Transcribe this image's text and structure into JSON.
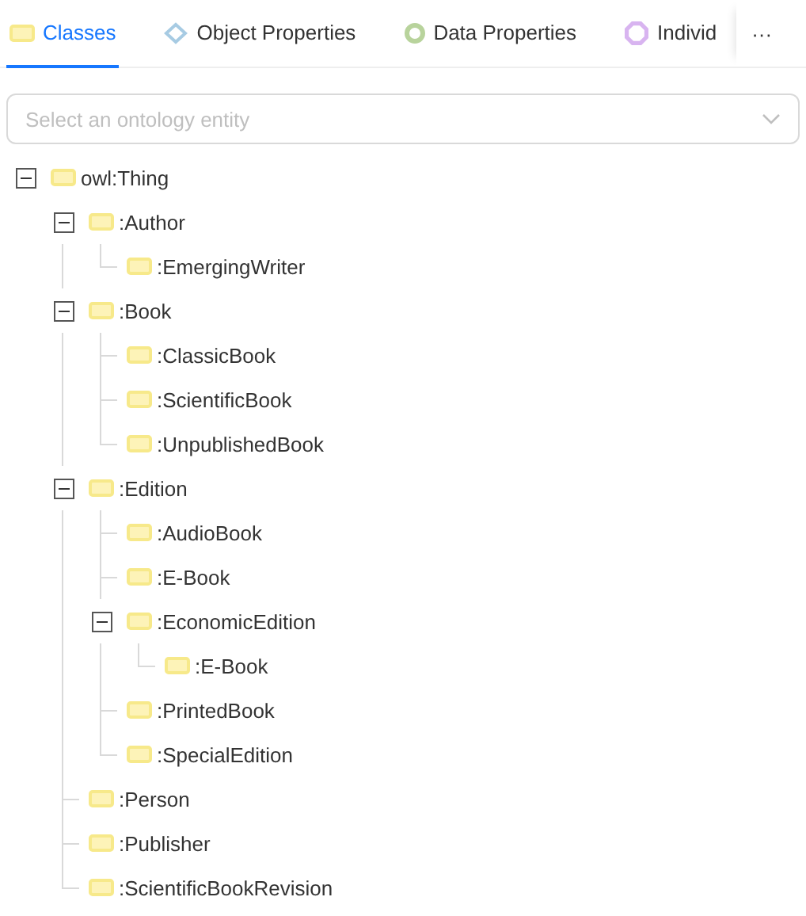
{
  "tabs": [
    {
      "label": "Classes",
      "kind": "class",
      "selected": true
    },
    {
      "label": "Object Properties",
      "kind": "object-property",
      "selected": false
    },
    {
      "label": "Data Properties",
      "kind": "data-property",
      "selected": false
    },
    {
      "label": "Individ",
      "kind": "individual",
      "selected": false
    }
  ],
  "more": "···",
  "search": {
    "placeholder": "Select an ontology entity"
  },
  "tree": [
    {
      "label": "owl:Thing",
      "expanded": true,
      "children": [
        {
          "label": ":Author",
          "expanded": true,
          "children": [
            {
              "label": ":EmergingWriter"
            }
          ]
        },
        {
          "label": ":Book",
          "expanded": true,
          "children": [
            {
              "label": ":ClassicBook"
            },
            {
              "label": ":ScientificBook"
            },
            {
              "label": ":UnpublishedBook"
            }
          ]
        },
        {
          "label": ":Edition",
          "expanded": true,
          "children": [
            {
              "label": ":AudioBook"
            },
            {
              "label": ":E-Book"
            },
            {
              "label": ":EconomicEdition",
              "expanded": true,
              "children": [
                {
                  "label": ":E-Book"
                }
              ]
            },
            {
              "label": ":PrintedBook"
            },
            {
              "label": ":SpecialEdition"
            }
          ]
        },
        {
          "label": ":Person"
        },
        {
          "label": ":Publisher"
        },
        {
          "label": ":ScientificBookRevision"
        }
      ]
    }
  ]
}
